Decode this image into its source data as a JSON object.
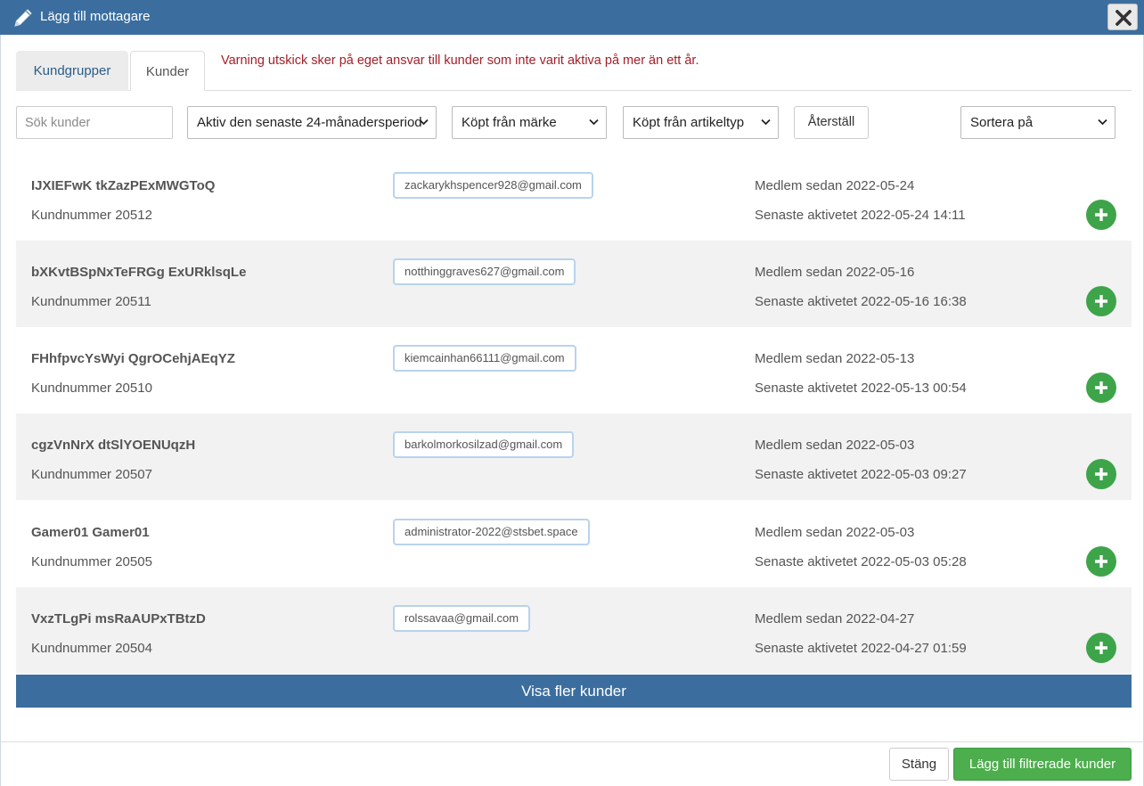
{
  "dialog": {
    "title": "Lägg till mottagare",
    "pencil_icon": "pencil-icon",
    "close_icon": "close-icon"
  },
  "tabs": [
    {
      "label": "Kundgrupper",
      "active": false
    },
    {
      "label": "Kunder",
      "active": true
    }
  ],
  "warning": "Varning utskick sker på eget ansvar till kunder som inte varit aktiva på mer än ett år.",
  "filters": {
    "search_placeholder": "Sök kunder",
    "period": "Aktiv den senaste 24-månadersperiod",
    "brand": "Köpt från märke",
    "article_type": "Köpt från artikeltyp",
    "reset_label": "Återställ",
    "sort": "Sortera på"
  },
  "customers": [
    {
      "name": "IJXIEFwK tkZazPExMWGToQ",
      "customer_no": "Kundnummer 20512",
      "email": "zackarykhspencer928@gmail.com",
      "member_since": "Medlem sedan 2022-05-24",
      "last_activity": "Senaste aktivetet 2022-05-24 14:11"
    },
    {
      "name": "bXKvtBSpNxTeFRGg ExURklsqLe",
      "customer_no": "Kundnummer 20511",
      "email": "notthinggraves627@gmail.com",
      "member_since": "Medlem sedan 2022-05-16",
      "last_activity": "Senaste aktivetet 2022-05-16 16:38"
    },
    {
      "name": "FHhfpvcYsWyi QgrOCehjAEqYZ",
      "customer_no": "Kundnummer 20510",
      "email": "kiemcainhan66111@gmail.com",
      "member_since": "Medlem sedan 2022-05-13",
      "last_activity": "Senaste aktivetet 2022-05-13 00:54"
    },
    {
      "name": "cgzVnNrX dtSlYOENUqzH",
      "customer_no": "Kundnummer 20507",
      "email": "barkolmorkosilzad@gmail.com",
      "member_since": "Medlem sedan 2022-05-03",
      "last_activity": "Senaste aktivetet 2022-05-03 09:27"
    },
    {
      "name": "Gamer01 Gamer01",
      "customer_no": "Kundnummer 20505",
      "email": "administrator-2022@stsbet.space",
      "member_since": "Medlem sedan 2022-05-03",
      "last_activity": "Senaste aktivetet 2022-05-03 05:28"
    },
    {
      "name": "VxzTLgPi msRaAUPxTBtzD",
      "customer_no": "Kundnummer 20504",
      "email": "rolssavaa@gmail.com",
      "member_since": "Medlem sedan 2022-04-27",
      "last_activity": "Senaste aktivetet 2022-04-27 01:59"
    }
  ],
  "show_more_label": "Visa fler kunder",
  "footer": {
    "close_label": "Stäng",
    "add_filtered_label": "Lägg till filtrerade kunder"
  },
  "colors": {
    "header": "#3b6e9e",
    "add": "#3ea44a",
    "warning": "#a32027"
  }
}
